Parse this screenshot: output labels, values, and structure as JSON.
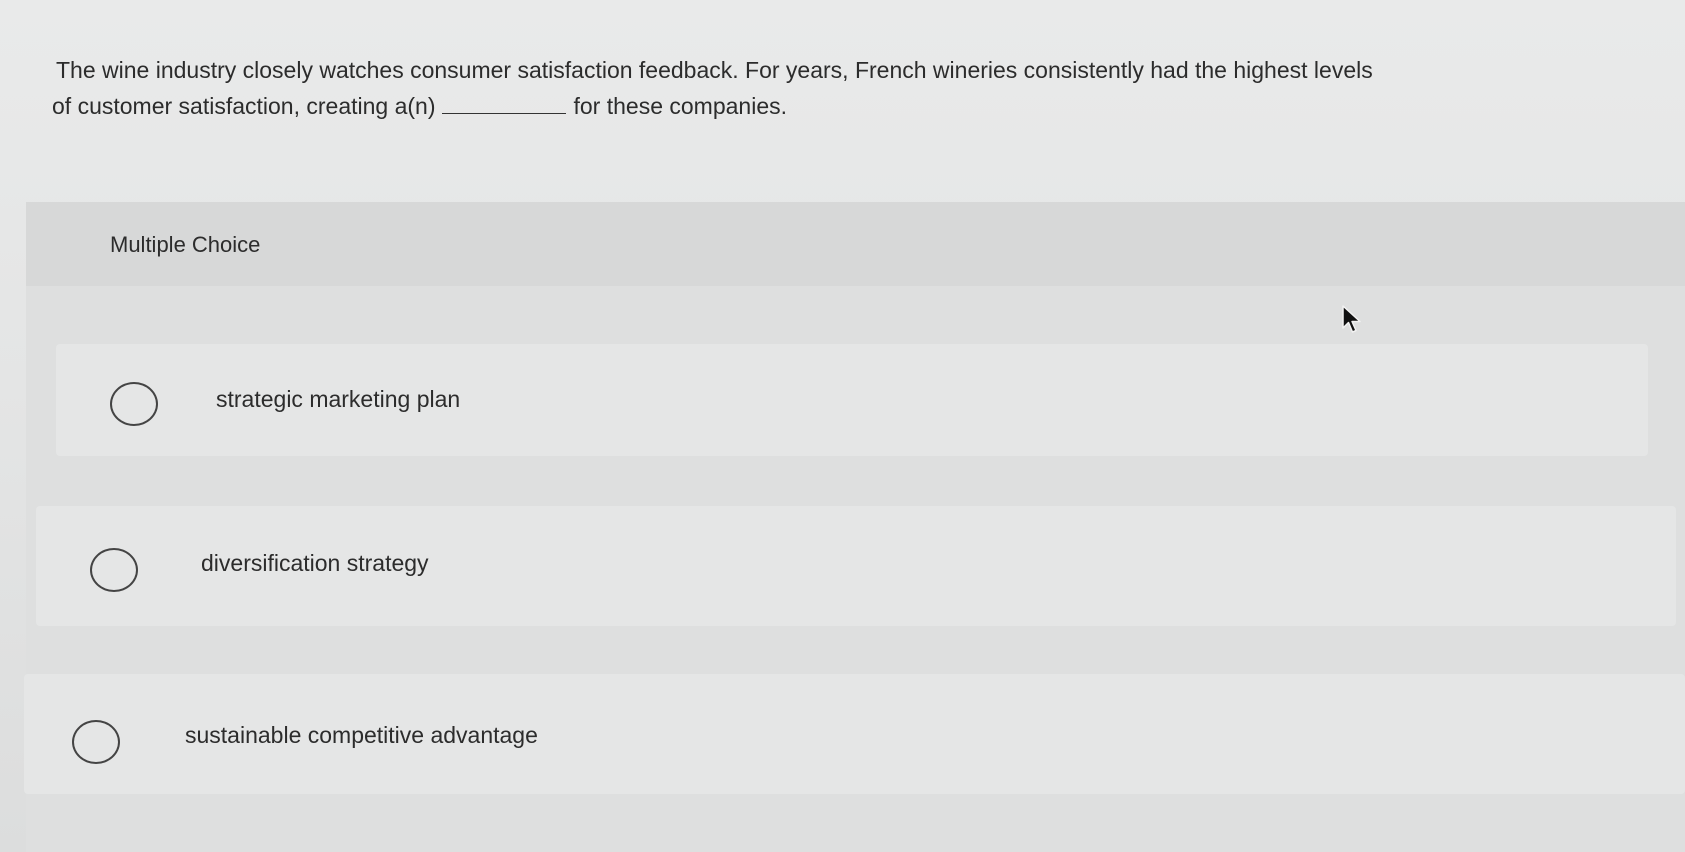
{
  "question": {
    "line1": "The wine industry closely watches consumer satisfaction feedback. For years, French wineries consistently had the highest levels",
    "line2_before": "of customer satisfaction, creating a(n)",
    "line2_after": "for these companies."
  },
  "multiple_choice": {
    "label": "Multiple Choice",
    "options": [
      {
        "label": "strategic marketing plan",
        "selected": false
      },
      {
        "label": "diversification strategy",
        "selected": false
      },
      {
        "label": "sustainable competitive advantage",
        "selected": false
      }
    ]
  },
  "icons": {
    "cursor": "mouse-pointer-icon",
    "radio": "radio-unchecked-icon"
  },
  "colors": {
    "background": "#e5e6e6",
    "text": "#2c2c2c",
    "radio_border": "#444444"
  }
}
